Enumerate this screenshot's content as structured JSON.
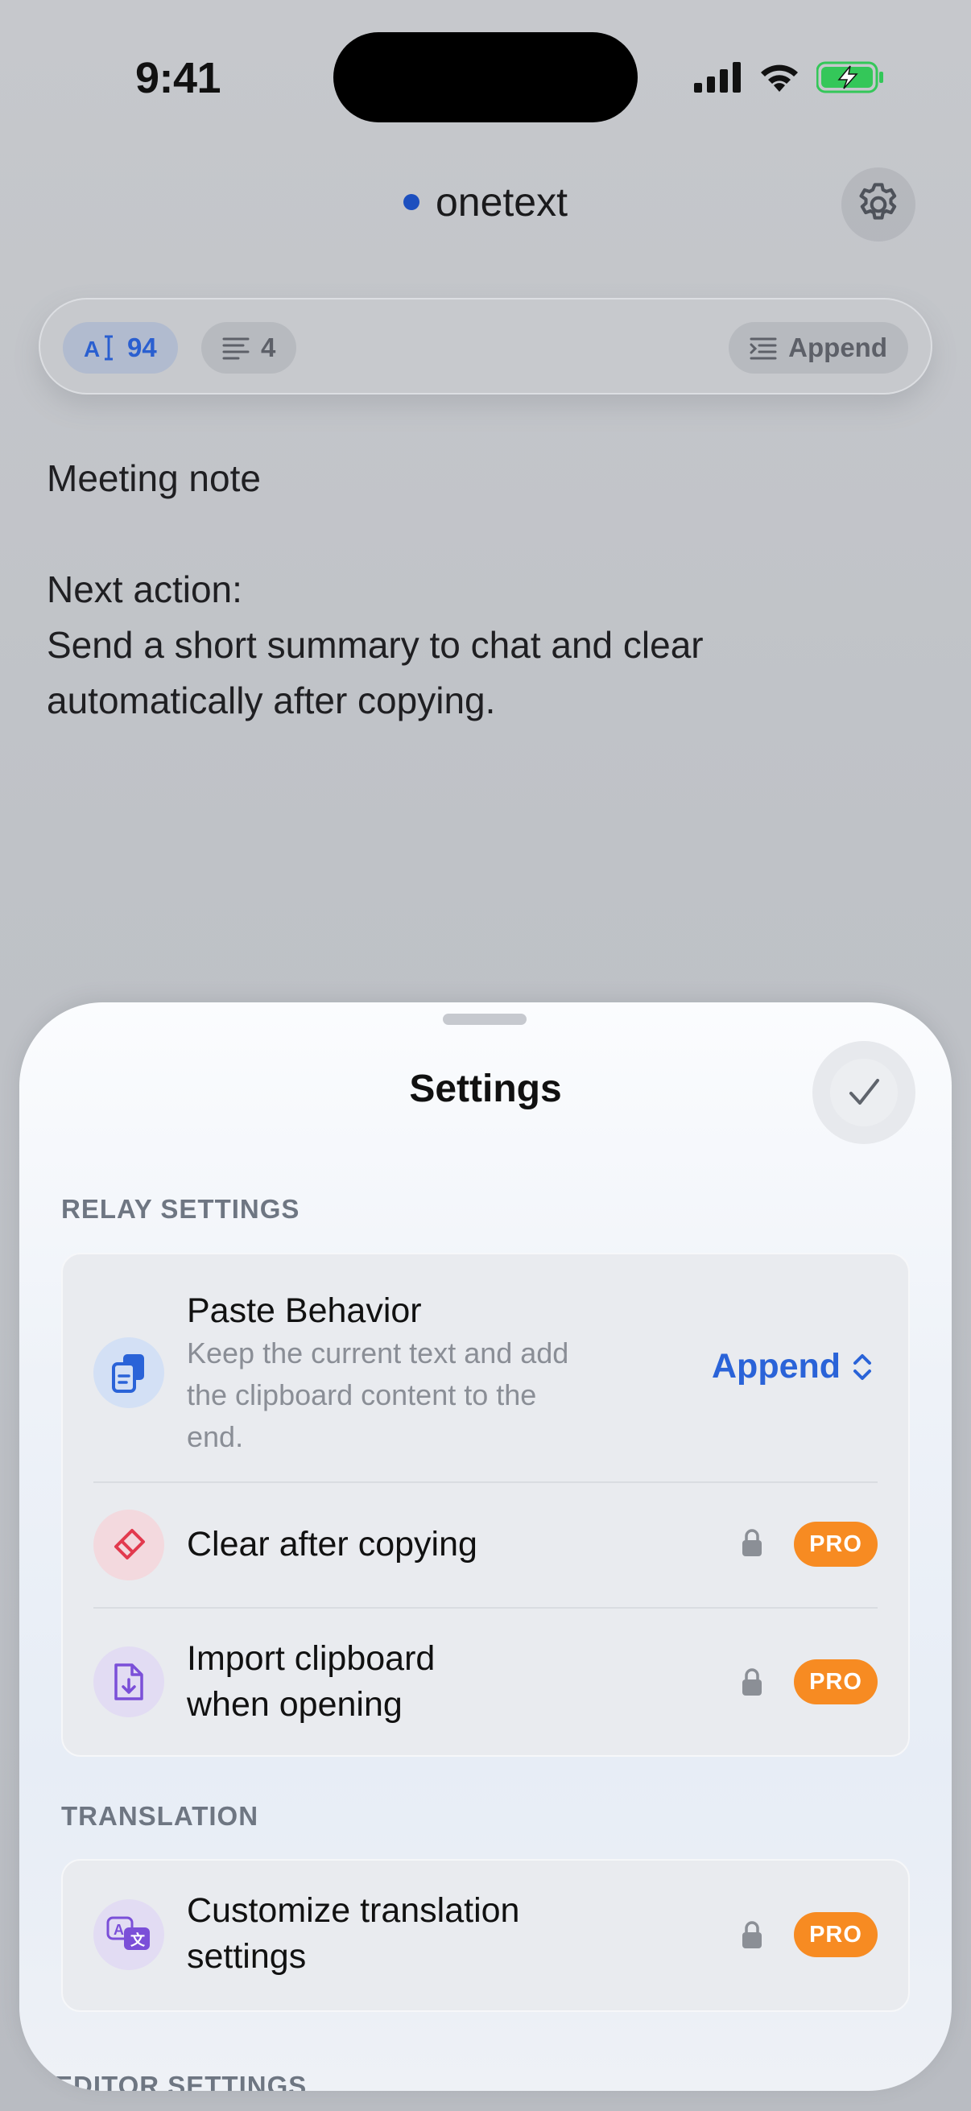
{
  "status_bar": {
    "time": "9:41"
  },
  "header": {
    "title": "onetext"
  },
  "toolbar": {
    "char_count": "94",
    "line_count": "4",
    "mode_label": "Append"
  },
  "editor": {
    "lines": [
      "Meeting note",
      "",
      "Next action:",
      "Send a short summary to chat and clear",
      "automatically after copying."
    ]
  },
  "sheet": {
    "title": "Settings",
    "sections": [
      {
        "label": "RELAY SETTINGS",
        "rows": [
          {
            "title": "Paste Behavior",
            "subtitle_lines": [
              "Keep the current text and add",
              "the clipboard content to the",
              "end."
            ],
            "value": "Append"
          },
          {
            "title": "Clear after copying",
            "badge": "PRO"
          },
          {
            "title_lines": [
              "Import clipboard",
              "when opening"
            ],
            "badge": "PRO"
          }
        ]
      },
      {
        "label": "TRANSLATION",
        "rows": [
          {
            "title_lines": [
              "Customize translation",
              "settings"
            ],
            "badge": "PRO"
          }
        ]
      },
      {
        "label": "EDITOR SETTINGS"
      }
    ]
  },
  "colors": {
    "accent_blue": "#2a63d8",
    "pro_orange": "#f78b22",
    "battery_green": "#34c759"
  },
  "icons": [
    "signal-icon",
    "wifi-icon",
    "battery-charging-icon",
    "gear-icon",
    "text-cursor-icon",
    "lines-icon",
    "append-icon",
    "checkmark-icon",
    "clipboard-icon",
    "eraser-icon",
    "import-file-icon",
    "translate-icon",
    "lock-icon",
    "chevron-updown-icon"
  ]
}
